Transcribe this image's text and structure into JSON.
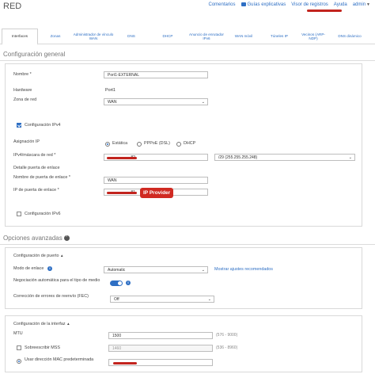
{
  "header": {
    "title": "RED",
    "links": {
      "comments": "Comentarios",
      "guides": "Guías explicativas",
      "log_viewer": "Visor de registros",
      "help": "Ayuda",
      "user": "admin"
    }
  },
  "tabs": [
    {
      "label": "Interfaces",
      "active": true
    },
    {
      "label": "Zonas"
    },
    {
      "label": "Administrador de vínculo WAN"
    },
    {
      "label": "DNS"
    },
    {
      "label": "DHCP"
    },
    {
      "label": "Anuncio de enrutador IPv6"
    },
    {
      "label": "WAN móvil"
    },
    {
      "label": "Túneles IP"
    },
    {
      "label": "Vecinos (ARP-NDP)"
    },
    {
      "label": "DNS dinámico"
    }
  ],
  "general": {
    "heading": "Configuración general",
    "name_label": "Nombre *",
    "name_value": "Port1-EXTERNAL",
    "hardware_label": "Hardware",
    "hardware_value": "Port1",
    "zone_label": "Zona de red",
    "zone_value": "WAN",
    "ipv4_label": "Configuración IPv4",
    "ip_assign_label": "Asignación IP",
    "ip_options": [
      "Estática",
      "PPPoE (DSL)",
      "DHCP"
    ],
    "ip_mask_label": "IPv4/máscara de red *",
    "ip_value": ".82",
    "mask_value": "/29 (255.255.255.248)",
    "gateway_detail_label": "Detalle puerta de enlace",
    "gateway_name_label": "Nombre de puerta de enlace *",
    "gateway_name_value": "WAN",
    "gateway_ip_label": "IP de puerta de enlace *",
    "gateway_ip_value": ".81",
    "ip_provider_badge": "IP Provider",
    "ipv6_label": "Configuración IPv6"
  },
  "advanced": {
    "heading": "Opciones avanzadas",
    "port_config_label": "Configuración de puerto",
    "link_mode_label": "Modo de enlace",
    "link_mode_value": "Automatic",
    "recommended_link": "Mostrar ajustes recomendados",
    "autoneg_label": "Negociación automática para el tipo de medio",
    "fec_label": "Corrección de errores de reenvío (FEC)",
    "fec_value": "Off",
    "interface_config_label": "Configuración de la interfaz",
    "mtu_label": "MTU",
    "mtu_value": "1500",
    "mtu_hint": "(576 - 9000)",
    "mss_label": "Sobreescribir MSS",
    "mss_value": "1460",
    "mss_hint": "(536 - 8960)",
    "mac_label": "Usar dirección MAC predeterminada"
  },
  "colors": {
    "accent": "#2e6fc4",
    "redaction": "#c2241e",
    "badge": "#d02a22"
  }
}
